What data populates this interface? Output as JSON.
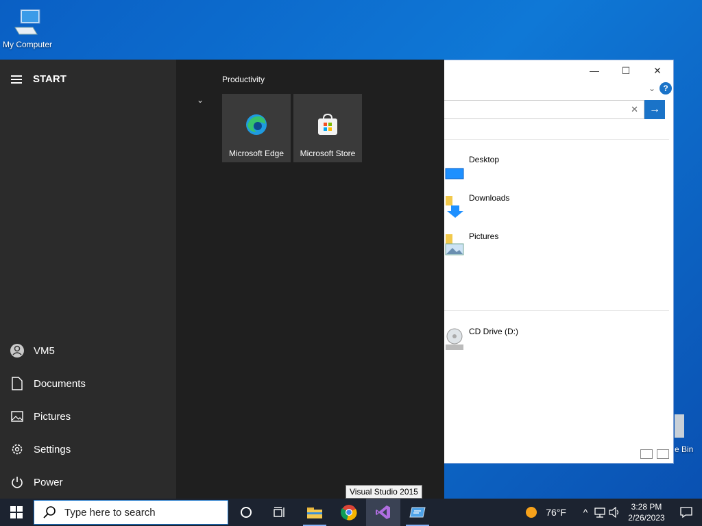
{
  "desktop": {
    "icons": [
      {
        "label": "My Computer"
      },
      {
        "label": "e Bin"
      }
    ]
  },
  "explorer": {
    "folders": [
      {
        "label": "Desktop"
      },
      {
        "label": "Downloads"
      },
      {
        "label": "Pictures"
      }
    ],
    "drives": [
      {
        "label": "CD Drive (D:)"
      }
    ]
  },
  "start_menu": {
    "title": "START",
    "user": "VM5",
    "links": [
      {
        "label": "Documents"
      },
      {
        "label": "Pictures"
      },
      {
        "label": "Settings"
      },
      {
        "label": "Power"
      }
    ],
    "group_title": "Productivity",
    "tiles": [
      {
        "label": "Microsoft Edge"
      },
      {
        "label": "Microsoft Store"
      }
    ]
  },
  "tooltip": "Visual Studio 2015",
  "taskbar": {
    "search_placeholder": "Type here to search",
    "weather": "76°F",
    "time": "3:28 PM",
    "date": "2/26/2023"
  },
  "colors": {
    "desktop_bg": "#0f78d6",
    "start_bg": "#1f1f1f",
    "taskbar_bg": "#1c2330",
    "accent": "#1a73c8"
  }
}
